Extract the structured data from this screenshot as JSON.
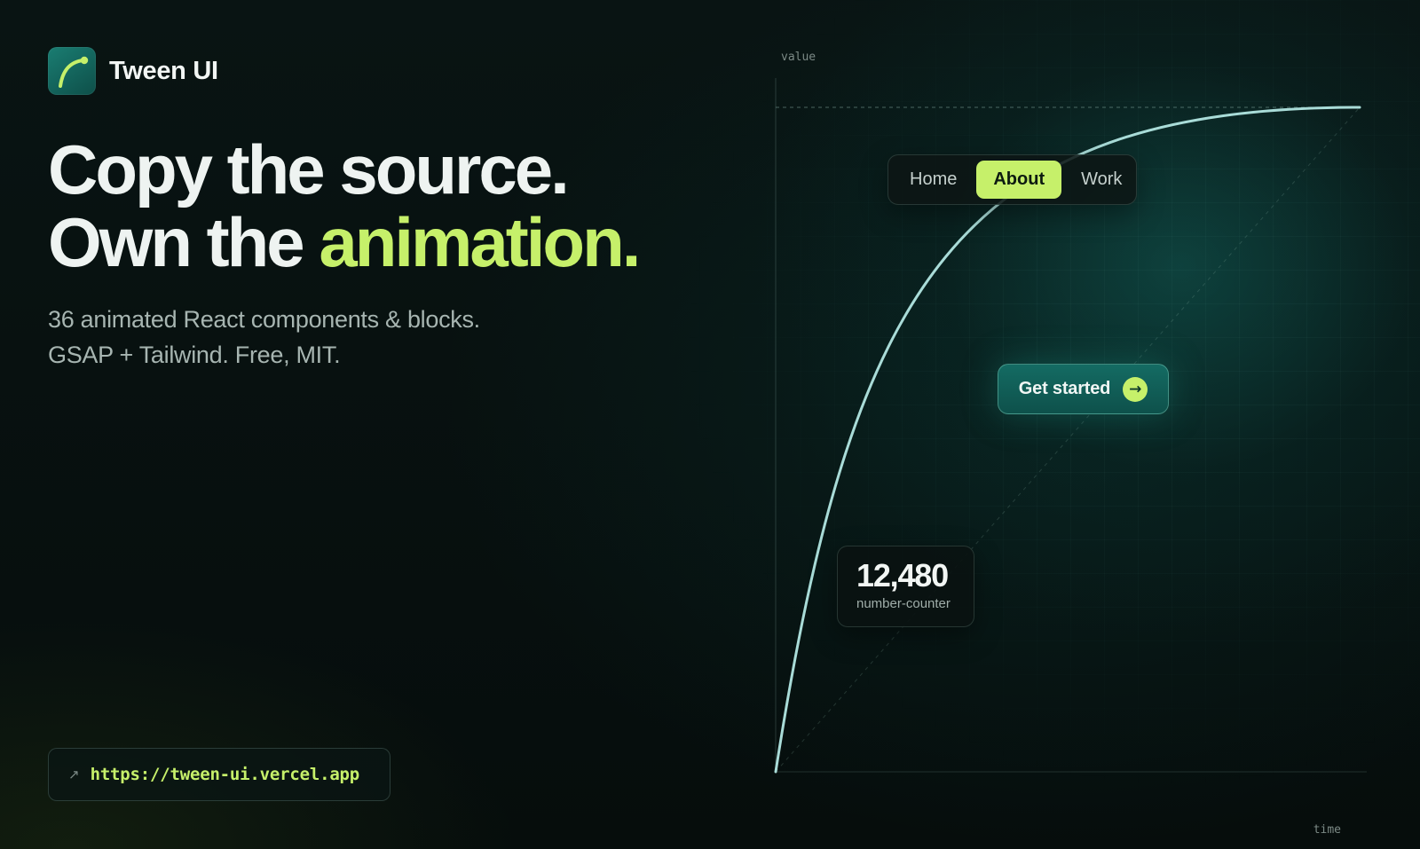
{
  "brand": {
    "name": "Tween UI",
    "logo_icon": "curve-icon"
  },
  "hero": {
    "line1": "Copy the source.",
    "line2_prefix": "Own the ",
    "line2_accent": "animation.",
    "subtitle_line1": "36 animated React components & blocks.",
    "subtitle_line2": "GSAP + Tailwind. Free, MIT."
  },
  "url_pill": {
    "arrow_icon": "arrow-up-right-icon",
    "arrow_glyph": "↗",
    "url": "https://tween-ui.vercel.app"
  },
  "chart": {
    "y_label": "value",
    "x_label": "time",
    "curve": "ease-out"
  },
  "nav": {
    "items": [
      "Home",
      "About",
      "Work"
    ],
    "active": "About"
  },
  "cta": {
    "label": "Get started",
    "icon": "arrow-right-icon",
    "glyph": "→"
  },
  "counter": {
    "value": "12,480",
    "label": "number-counter"
  },
  "colors": {
    "accent": "#c6f06a",
    "teal": "#146b63",
    "background": "#07100f",
    "curve": "#a9dcd8"
  }
}
